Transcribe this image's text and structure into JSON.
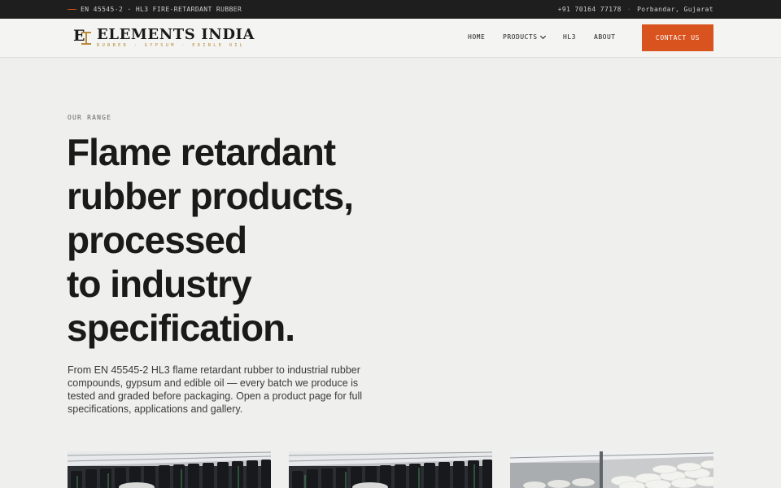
{
  "topbar": {
    "standard": "EN 45545-2 · HL3 FIRE-RETARDANT RUBBER",
    "phone": "+91 70164 77178",
    "separator": "·",
    "location": "Porbandar, Gujarat",
    "accent_color": "#d2531f"
  },
  "brand": {
    "name": "ELEMENTS INDIA",
    "tagline": "RUBBER · GYPSUM · EDIBLE OIL",
    "monogram_letter": "E",
    "gold_color": "#b98a3c"
  },
  "nav": {
    "items": [
      {
        "label": "HOME"
      },
      {
        "label": "PRODUCTS",
        "icon": "chevron-down-icon"
      },
      {
        "label": "HL3"
      },
      {
        "label": "ABOUT"
      }
    ],
    "cta_label": "CONTACT US",
    "cta_color": "#d9531e"
  },
  "hero": {
    "eyebrow": "OUR RANGE",
    "headline_lines": [
      "Flame retardant",
      "rubber products,",
      "processed",
      "to industry",
      "specification."
    ],
    "lede": "From EN 45545-2 HL3 flame retardant rubber to industrial rubber compounds, gypsum and edible oil — every batch we produce is tested and graded before packaging. Open a product page for full specifications, applications and gallery."
  },
  "cards": [
    {
      "image": "warehouse-rubber-rolls-photo"
    },
    {
      "image": "warehouse-rubber-rolls-photo"
    },
    {
      "image": "warehouse-white-sacks-photo"
    }
  ]
}
